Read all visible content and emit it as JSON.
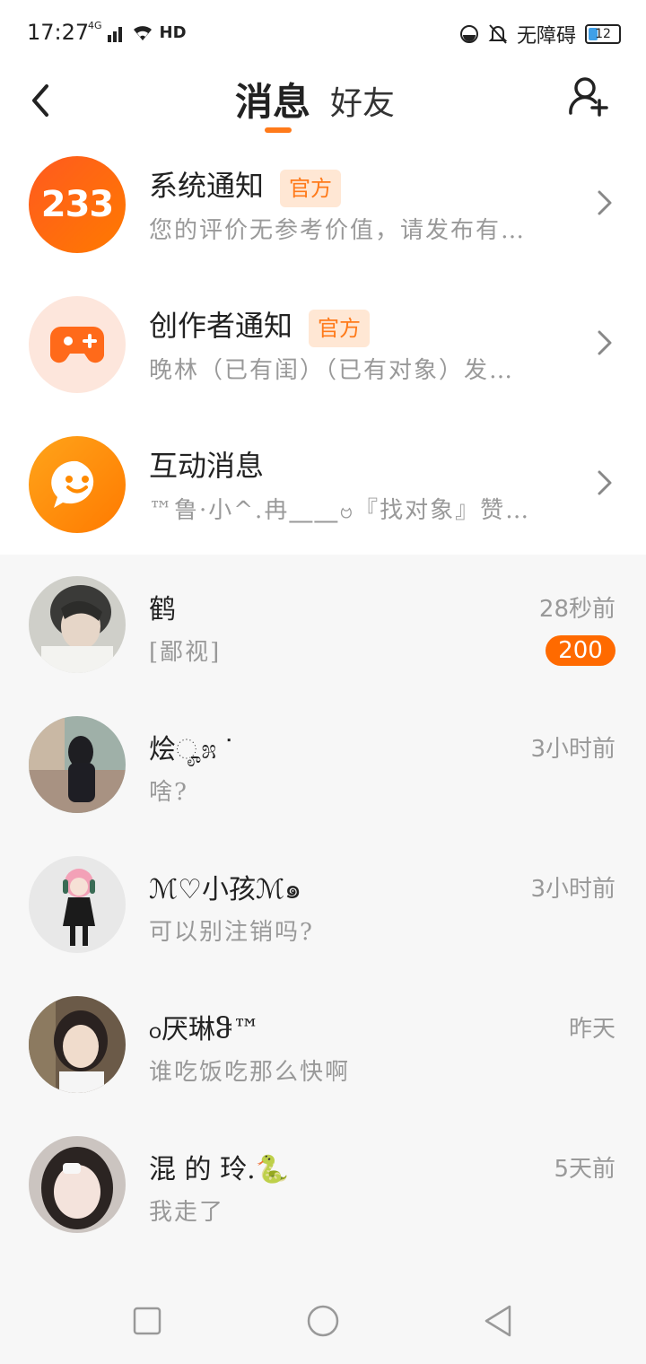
{
  "status_bar": {
    "time": "17:27",
    "network": "4G",
    "hd": "HD",
    "accessibility": "无障碍",
    "battery": "12"
  },
  "header": {
    "back_icon": "back-arrow-icon",
    "tab_active": "消息",
    "tab_inactive": "好友",
    "add_friend_icon": "add-friend-icon"
  },
  "colors": {
    "accent": "#ff7a1a",
    "badge_bg": "#ffe7d4",
    "unread": "#ff6a00"
  },
  "notifications": [
    {
      "title": "系统通知",
      "badge": "官方",
      "preview": "您的评价无参考价值，请发布有…",
      "avatar_text": "233"
    },
    {
      "title": "创作者通知",
      "badge": "官方",
      "preview": "晚林（已有闺）（已有对象）发…"
    },
    {
      "title": "互动消息",
      "preview": "™鲁·小^.冉⎽⎽ဗ『找对象』赞…"
    }
  ],
  "chats": [
    {
      "name": "鹤",
      "message": "[鄙视]",
      "time": "28秒前",
      "unread": "200"
    },
    {
      "name": "烩ೄ೫ ᐝ",
      "message": "啥?",
      "time": "3小时前"
    },
    {
      "name": "ℳ♡小孩ℳ๑",
      "message": "可以别注销吗?",
      "time": "3小时前"
    },
    {
      "name": "ჿ厌琳ჵ™",
      "message": "谁吃饭吃那么快啊",
      "time": "昨天"
    },
    {
      "name": "混 的 玲.🐍",
      "message": "我走了",
      "time": "5天前"
    }
  ]
}
